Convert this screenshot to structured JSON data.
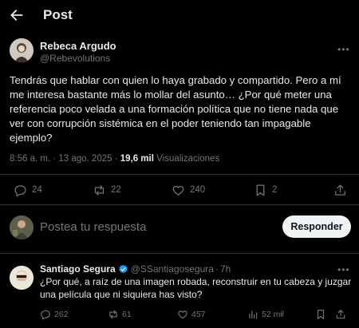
{
  "header": {
    "title": "Post"
  },
  "tweet": {
    "author_name": "Rebeca Argudo",
    "author_handle": "@Rebevolutions",
    "text": "Tendrás que hablar con quien lo haya grabado y compartido. Pero a mí me interesa bastante más lo mollar del asunto… ¿Por qué meter una referencia poco velada a una formación política que no tiene nada que ver con corrupción sistémica en el poder teniendo tan impagable ejemplo?",
    "timestamp": "8:56 a. m. · 13 ago. 2025 · ",
    "views_count": "19,6 mil",
    "views_label": " Visualizaciones",
    "replies": "24",
    "reposts": "22",
    "likes": "240",
    "bookmarks": "2"
  },
  "reply_box": {
    "placeholder": "Postea tu respuesta",
    "button_label": "Responder"
  },
  "comment": {
    "author_name": "Santiago Segura",
    "author_handle": "@SSantiagosegura",
    "separator": "·",
    "time": "7h",
    "text": "¿Por qué, a raíz de una imagen robada, reconstruir en tu cabeza y juzgar una película que ni siquiera has visto?",
    "replies": "262",
    "reposts": "61",
    "likes": "457",
    "views": "52 mil"
  },
  "colors": {
    "background": "#000000",
    "text": "#e7e9ea",
    "muted": "#71767b",
    "border": "#2f3336",
    "verified": "#1d9bf0",
    "button_bg": "#eff3f4"
  },
  "icons": [
    "back-arrow-icon",
    "more-icon",
    "reply-icon",
    "repost-icon",
    "like-icon",
    "bookmark-icon",
    "share-icon",
    "verified-icon",
    "views-icon"
  ]
}
